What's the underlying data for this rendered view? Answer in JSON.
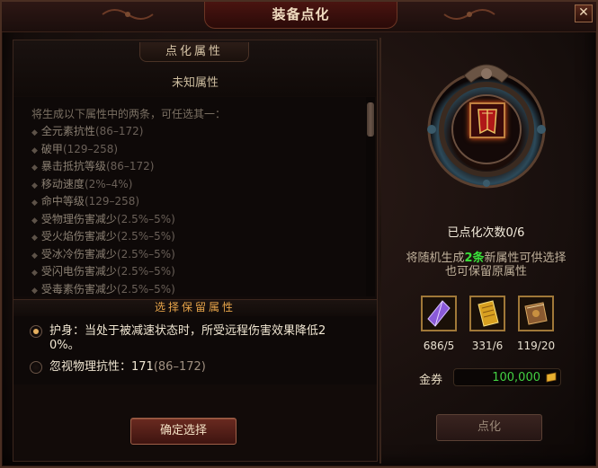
{
  "window": {
    "title": "装备点化",
    "close_glyph": "✕"
  },
  "attributes": {
    "section_title": "点化属性",
    "current_value": "未知属性",
    "intro": "将生成以下属性中的两条，可任选其一：",
    "items": [
      {
        "name": "全元素抗性",
        "range": "(86–172)"
      },
      {
        "name": "破甲",
        "range": "(129–258)"
      },
      {
        "name": "暴击抵抗等级",
        "range": "(86–172)"
      },
      {
        "name": "移动速度",
        "range": "(2%–4%)"
      },
      {
        "name": "命中等级",
        "range": "(129–258)"
      },
      {
        "name": "受物理伤害减少",
        "range": "(2.5%–5%)"
      },
      {
        "name": "受火焰伤害减少",
        "range": "(2.5%–5%)"
      },
      {
        "name": "受冰冷伤害减少",
        "range": "(2.5%–5%)"
      },
      {
        "name": "受闪电伤害减少",
        "range": "(2.5%–5%)"
      },
      {
        "name": "受毒素伤害减少",
        "range": "(2.5%–5%)"
      }
    ]
  },
  "retain": {
    "section_title": "选择保留属性",
    "options": [
      {
        "text_line1": "护身：当处于被减速状态时，所受远程伤害效果降低2",
        "text_line2": "0%。",
        "checked": true
      },
      {
        "text": "忽视物理抗性：171",
        "range": "(86–172)",
        "checked": false
      }
    ],
    "confirm_label": "确定选择"
  },
  "refine": {
    "count_text": "已点化次数0/6",
    "info_pre": "将随机生成",
    "info_highlight": "2条",
    "info_post": "新属性可供选择",
    "info_line2": "也可保留原属性",
    "materials": [
      {
        "icon": "purple-crystal-icon",
        "count": "686/5"
      },
      {
        "icon": "golden-scroll-icon",
        "count": "331/6"
      },
      {
        "icon": "spellbook-icon",
        "count": "119/20"
      }
    ],
    "gold_label": "金券",
    "gold_value": "100,000",
    "button_label": "点化"
  },
  "colors": {
    "accent_gold": "#e8a54a",
    "highlight_green": "#3adf3a",
    "gold_value_green": "#42d042"
  }
}
